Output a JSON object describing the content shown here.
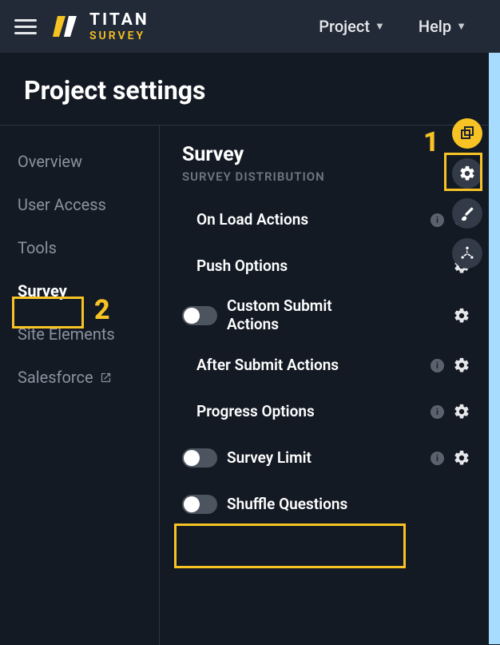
{
  "brand": {
    "name": "TITAN",
    "product": "SURVEY"
  },
  "header": {
    "project_label": "Project",
    "help_label": "Help"
  },
  "page_title": "Project settings",
  "side_nav": {
    "overview": "Overview",
    "user_access": "User Access",
    "tools": "Tools",
    "survey": "Survey",
    "site_elements": "Site Elements",
    "salesforce": "Salesforce"
  },
  "panel": {
    "title": "Survey",
    "subtitle": "SURVEY DISTRIBUTION",
    "rows": {
      "on_load_actions": "On Load Actions",
      "push_options": "Push Options",
      "custom_submit_actions": "Custom Submit Actions",
      "after_submit_actions": "After Submit Actions",
      "progress_options": "Progress Options",
      "survey_limit": "Survey Limit",
      "shuffle_questions": "Shuffle Questions"
    }
  },
  "callouts": {
    "one": "1",
    "two": "2"
  },
  "colors": {
    "accent": "#f7c324",
    "bg": "#141a24",
    "bg2": "#222a37"
  }
}
